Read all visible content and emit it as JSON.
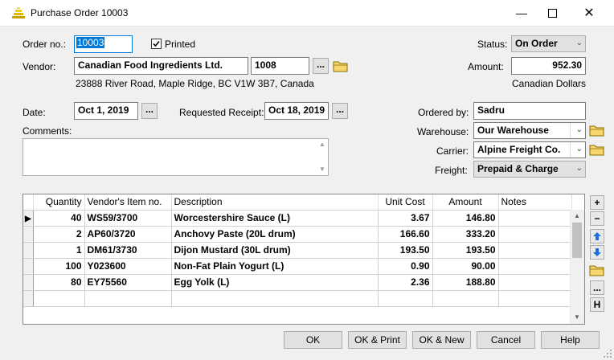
{
  "window": {
    "title": "Purchase Order 10003",
    "icon": "purchase-order-app-icon"
  },
  "order": {
    "label": "Order no.:",
    "value": "10003"
  },
  "printed": {
    "label": "Printed",
    "checked": true
  },
  "status": {
    "label": "Status:",
    "value": "On Order"
  },
  "vendor": {
    "label": "Vendor:",
    "name": "Canadian Food Ingredients Ltd.",
    "code": "1008",
    "address": "23888 River Road, Maple Ridge, BC  V1W 3B7, Canada"
  },
  "amount": {
    "label": "Amount:",
    "value": "952.30",
    "currency": "Canadian Dollars"
  },
  "date": {
    "label": "Date:",
    "value": "Oct 1, 2019"
  },
  "requested_receipt": {
    "label": "Requested Receipt:",
    "value": "Oct 18, 2019"
  },
  "ordered_by": {
    "label": "Ordered by:",
    "value": "Sadru"
  },
  "comments": {
    "label": "Comments:",
    "value": ""
  },
  "warehouse": {
    "label": "Warehouse:",
    "value": "Our Warehouse"
  },
  "carrier": {
    "label": "Carrier:",
    "value": "Alpine Freight Co."
  },
  "freight": {
    "label": "Freight:",
    "value": "Prepaid & Charge"
  },
  "browse_label": "...",
  "table": {
    "columns": [
      "Quantity",
      "Vendor's Item no.",
      "Description",
      "Unit Cost",
      "Amount",
      "Notes"
    ],
    "rows": [
      {
        "qty": "40",
        "item": "WS59/3700",
        "desc": "Worcestershire Sauce (L)",
        "unit": "3.67",
        "amount": "146.80",
        "notes": ""
      },
      {
        "qty": "2",
        "item": "AP60/3720",
        "desc": "Anchovy Paste (20L drum)",
        "unit": "166.60",
        "amount": "333.20",
        "notes": ""
      },
      {
        "qty": "1",
        "item": "DM61/3730",
        "desc": "Dijon Mustard (30L drum)",
        "unit": "193.50",
        "amount": "193.50",
        "notes": ""
      },
      {
        "qty": "100",
        "item": "Y023600",
        "desc": "Non-Fat Plain Yogurt (L)",
        "unit": "0.90",
        "amount": "90.00",
        "notes": ""
      },
      {
        "qty": "80",
        "item": "EY75560",
        "desc": "Egg Yolk (L)",
        "unit": "2.36",
        "amount": "188.80",
        "notes": ""
      }
    ]
  },
  "side_buttons": {
    "add": "+",
    "remove": "−",
    "more": "...",
    "history": "H"
  },
  "buttons": {
    "ok": "OK",
    "ok_print": "OK & Print",
    "ok_new": "OK & New",
    "cancel": "Cancel",
    "help": "Help"
  },
  "colors": {
    "selection": "#0078d7",
    "folder": "#f5d76e"
  }
}
